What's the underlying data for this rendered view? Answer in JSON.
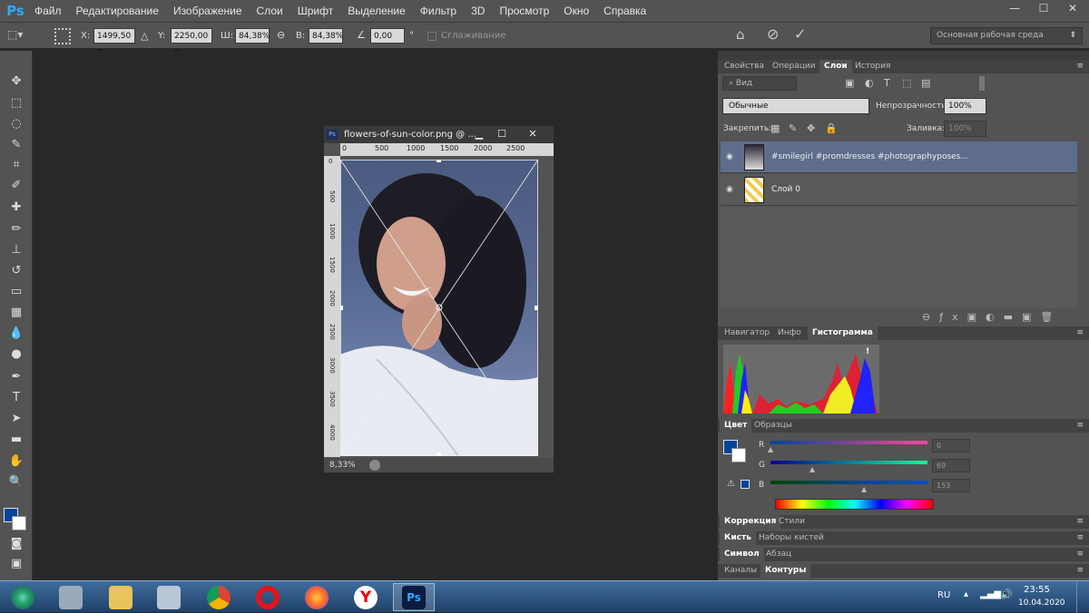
{
  "app": {
    "logo": "Ps",
    "menu": [
      "Файл",
      "Редактирование",
      "Изображение",
      "Слои",
      "Шрифт",
      "Выделение",
      "Фильтр",
      "3D",
      "Просмотр",
      "Окно",
      "Справка"
    ],
    "window_controls": {
      "minimize": "—",
      "maximize": "☐",
      "close": "✕"
    }
  },
  "options": {
    "x_label": "X:",
    "x_value": "1499,50 п",
    "y_label": "Y:",
    "y_value": "2250,00 п",
    "w_label": "Ш:",
    "w_value": "84,38%",
    "h_label": "В:",
    "h_value": "84,38%",
    "angle_value": "0,00",
    "degree": "°",
    "antialias_label": "Сглаживание",
    "workspace": "Основная рабочая среда"
  },
  "document": {
    "title": "flowers-of-sun-color.png @ ...",
    "ps_badge": "Ps",
    "ruler_h_ticks": [
      "0",
      "500",
      "1000",
      "1500",
      "2000",
      "2500"
    ],
    "ruler_v_ticks": [
      "0",
      "500",
      "1000",
      "1500",
      "2000",
      "2500",
      "3000",
      "3500",
      "4000"
    ],
    "zoom": "8,33%"
  },
  "panels": {
    "top_tabs": [
      "Свойства",
      "Операции",
      "Слои",
      "История"
    ],
    "active_top_tab": "Слои",
    "search_kind": "Вид",
    "blend_mode": "Обычные",
    "opacity_label": "Непрозрачность:",
    "opacity_value": "100%",
    "lock_label": "Закрепить:",
    "fill_label": "Заливка:",
    "fill_value": "100%",
    "layers": [
      {
        "name": "#smilegirl #promdresses #photographyposes...",
        "selected": true
      },
      {
        "name": "Слой 0",
        "selected": false
      }
    ],
    "mid_tabs": [
      "Навигатор",
      "Инфо",
      "Гистограмма"
    ],
    "active_mid_tab": "Гистограмма",
    "histogram_warning": "!",
    "color_tabs": [
      "Цвет",
      "Образцы"
    ],
    "active_color_tab": "Цвет",
    "channels": [
      {
        "label": "R",
        "value": "0"
      },
      {
        "label": "G",
        "value": "69"
      },
      {
        "label": "B",
        "value": "153"
      }
    ],
    "foreground_color": "#004599",
    "collapsed_rows": [
      {
        "tabs": [
          "Коррекция",
          "Стили"
        ],
        "active": "Коррекция"
      },
      {
        "tabs": [
          "Кисть",
          "Наборы кистей"
        ],
        "active": "Кисть"
      },
      {
        "tabs": [
          "Символ",
          "Абзац"
        ],
        "active": "Символ"
      },
      {
        "tabs": [
          "Каналы",
          "Контуры"
        ],
        "active": "Контуры"
      }
    ]
  },
  "taskbar": {
    "lang": "RU",
    "time": "23:55",
    "date": "10.04.2020",
    "apps": [
      "start-button",
      "keyboard-app",
      "file-explorer",
      "calculator",
      "chrome",
      "opera",
      "firefox",
      "yandex-browser",
      "photoshop"
    ]
  }
}
